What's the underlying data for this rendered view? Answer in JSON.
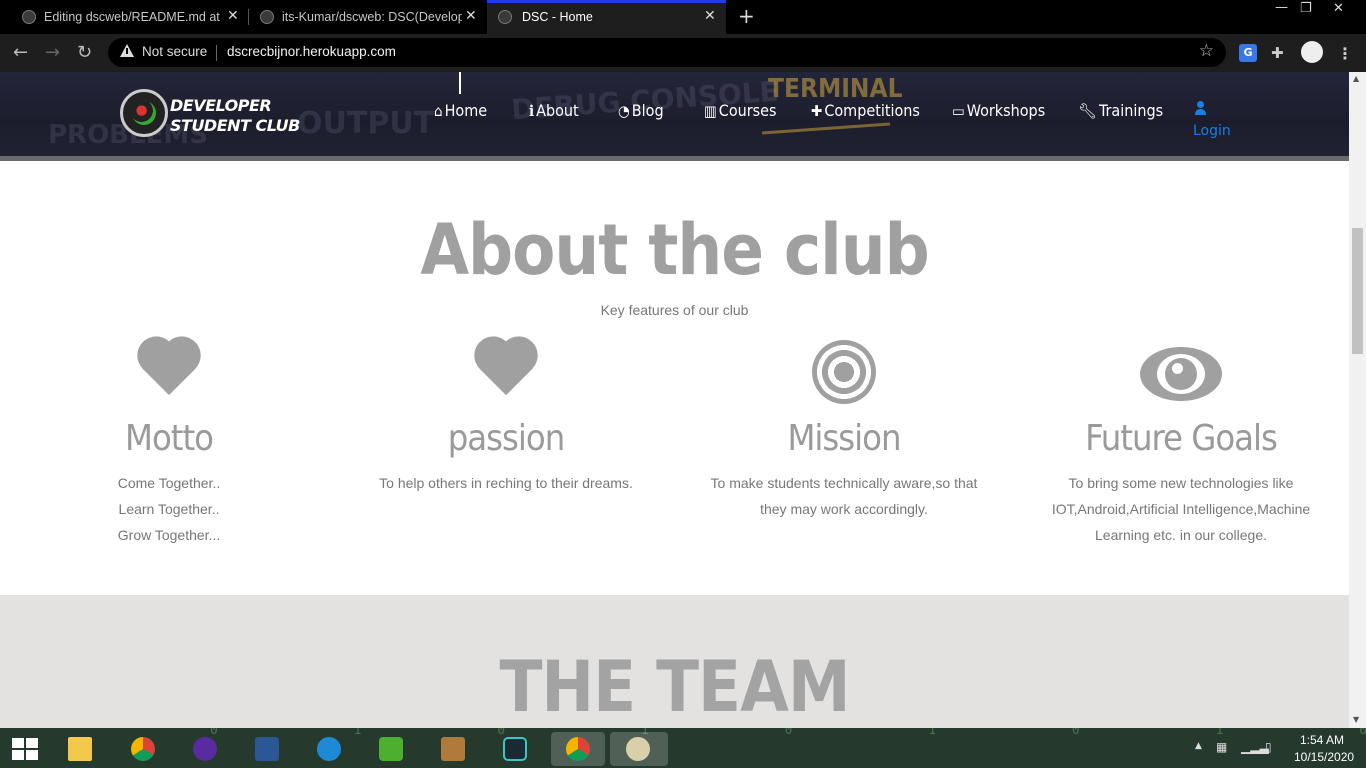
{
  "browser": {
    "tabs": [
      {
        "title": "Editing dscweb/README.md at m",
        "active": false
      },
      {
        "title": "its-Kumar/dscweb: DSC(Develop",
        "active": false
      },
      {
        "title": "DSC - Home",
        "active": true
      }
    ],
    "close_glyph": "✕",
    "new_tab_glyph": "+",
    "security_label": "Not secure",
    "url": "dscrecbijnor.herokuapp.com",
    "window_controls": [
      "—",
      "❐",
      "✕"
    ]
  },
  "site": {
    "logo_text": [
      "DEVELOPER",
      "STUDENT CLUB"
    ],
    "background_words": [
      "PROBLEMS",
      "OUTPUT",
      "DEBUG CONSOLE",
      "TERMINAL"
    ],
    "nav": [
      {
        "label": "Home",
        "icon": "home-icon"
      },
      {
        "label": "About",
        "icon": "info-icon"
      },
      {
        "label": "Blog",
        "icon": "rss-icon"
      },
      {
        "label": "Courses",
        "icon": "book-icon"
      },
      {
        "label": "Competitions",
        "icon": "puzzle-icon"
      },
      {
        "label": "Workshops",
        "icon": "laptop-icon"
      },
      {
        "label": "Trainings",
        "icon": "wrench-icon"
      }
    ],
    "login_label": "Login",
    "accent_color": "#1a7ee6"
  },
  "about": {
    "title": "About the club",
    "subtitle": "Key features of our club",
    "features": [
      {
        "icon": "heart-icon",
        "title": "Motto",
        "lines": [
          "Come Together..",
          "Learn Together..",
          "Grow Together..."
        ]
      },
      {
        "icon": "heart-icon",
        "title": "passion",
        "lines": [
          "To help others in reching to their dreams."
        ]
      },
      {
        "icon": "target-icon",
        "title": "Mission",
        "lines": [
          "To make students technically aware,so that",
          "they may work accordingly."
        ]
      },
      {
        "icon": "eye-icon",
        "title": "Future Goals",
        "lines": [
          "To bring some new technologies like",
          "IOT,Android,Artificial Intelligence,Machine",
          "Learning etc. in our college."
        ]
      }
    ]
  },
  "team": {
    "title": "THE TEAM"
  },
  "taskbar": {
    "bits": "0 1 0 1 0 1 0 1 0 1 0 1 0 1",
    "clock_time": "1:54 AM",
    "clock_date": "10/15/2020"
  }
}
